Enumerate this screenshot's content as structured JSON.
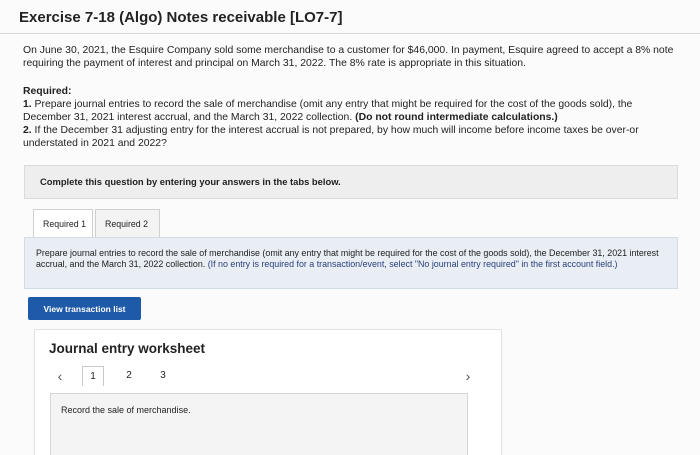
{
  "header": {
    "title": "Exercise 7-18 (Algo) Notes receivable [LO7-7]"
  },
  "problem": {
    "text": "On June 30, 2021, the Esquire Company sold some merchandise to a customer for $46,000. In payment, Esquire agreed to accept a 8% note requiring the payment of interest and principal on March 31, 2022. The 8% rate is appropriate in this situation."
  },
  "required": {
    "title": "Required:",
    "item1_label": "1.",
    "item1_text": " Prepare journal entries to record the sale of merchandise (omit any entry that might be required for the cost of the goods sold), the December 31, 2021 interest accrual, and the March 31, 2022 collection. ",
    "item1_bold": "(Do not round intermediate calculations.)",
    "item2_label": "2.",
    "item2_text": " If the December 31 adjusting entry for the interest accrual is not prepared, by how much will income before income taxes be over-or understated in 2021 and 2022?"
  },
  "instruction": "Complete this question by entering your answers in the tabs below.",
  "tabs": [
    {
      "label": "Required 1"
    },
    {
      "label": "Required 2"
    }
  ],
  "tab_panel": {
    "text": "Prepare journal entries to record the sale of merchandise (omit any entry that might be required for the cost of the goods sold), the December 31, 2021 interest accrual, and the March 31, 2022 collection. ",
    "note": "(If no entry is required for a transaction/event, select \"No journal entry required\" in the first account field.)"
  },
  "view_button": "View transaction list",
  "worksheet": {
    "title": "Journal entry worksheet",
    "pages": [
      "1",
      "2",
      "3"
    ],
    "prev_icon": "chevron-left-icon",
    "next_icon": "chevron-right-icon",
    "entry_description": "Record the sale of merchandise."
  }
}
